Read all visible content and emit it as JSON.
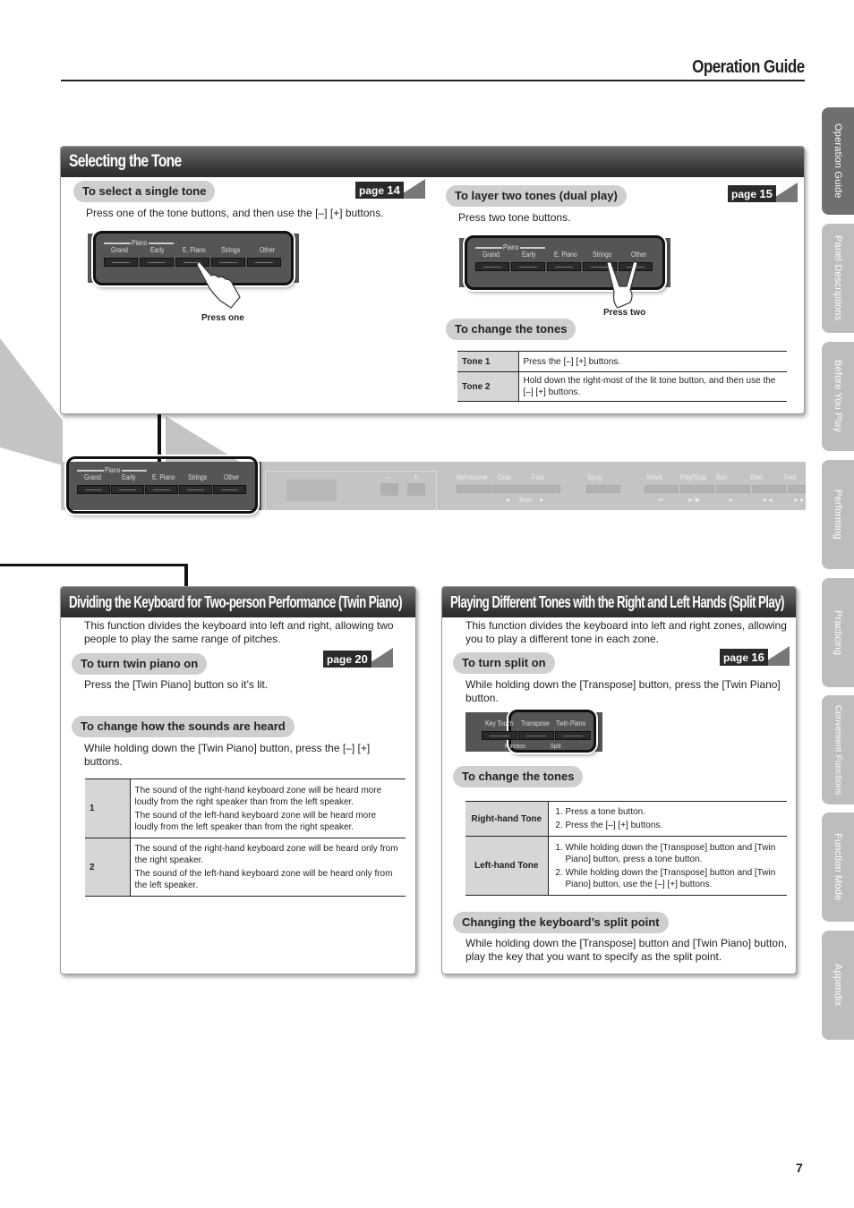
{
  "header": {
    "title": "Operation Guide"
  },
  "side_tabs": [
    {
      "label": "Operation Guide",
      "active": true
    },
    {
      "label": "Panel Descriptions",
      "active": false
    },
    {
      "label": "Before You Play",
      "active": false
    },
    {
      "label": "Performing",
      "active": false
    },
    {
      "label": "Practicing",
      "active": false
    },
    {
      "label": "Convenient Functions",
      "active": false
    },
    {
      "label": "Function Mode",
      "active": false
    },
    {
      "label": "Appendix",
      "active": false
    }
  ],
  "tone_buttons": {
    "group_label": "Piano",
    "labels": [
      "Grand",
      "Early",
      "E. Piano",
      "Strings",
      "Other"
    ]
  },
  "selecting_tone": {
    "title": "Selecting the Tone",
    "single": {
      "heading": "To select a single tone",
      "page_prefix": "page",
      "page_number": "14",
      "text": "Press one of the tone buttons, and then use the [–] [+] buttons.",
      "caption": "Press one"
    },
    "dual": {
      "heading": "To layer two tones (dual play)",
      "page_prefix": "page",
      "page_number": "15",
      "text": "Press two tone buttons.",
      "caption": "Press two"
    },
    "change": {
      "heading": "To change the tones",
      "rows": [
        {
          "label": "Tone 1",
          "text": "Press the [–] [+] buttons."
        },
        {
          "label": "Tone 2",
          "text": "Hold down the right-most of the lit tone button, and then use the [–] [+] buttons."
        }
      ]
    }
  },
  "front_panel": {
    "minus": "–",
    "plus": "+",
    "buttons": [
      "Metronome",
      "Slow",
      "Fast",
      "Song",
      "Reset",
      "Play/Stop",
      "Rec",
      "Bwd",
      "Fwd"
    ],
    "beat_label": "Beat",
    "sub_symbols": [
      "◄",
      "►",
      "⏮",
      "►/■",
      "●",
      "◄◄",
      "►►"
    ]
  },
  "twin_piano": {
    "title": "Dividing the Keyboard for Two-person Performance (Twin Piano)",
    "intro": "This function divides the keyboard into left and right, allowing two people to play the same range of pitches.",
    "turn_on": {
      "heading": "To turn twin piano on",
      "page_prefix": "page",
      "page_number": "20",
      "text": "Press the [Twin Piano] button so it’s lit."
    },
    "sounds": {
      "heading": "To change how the sounds are heard",
      "text": "While holding down the [Twin Piano] button, press the [–] [+] buttons.",
      "rows": [
        {
          "label": "1",
          "lines": [
            "The sound of the right-hand keyboard zone will be heard more loudly from the right speaker than from the left speaker.",
            "The sound of the left-hand keyboard zone will be heard more loudly from the left speaker than from the right speaker."
          ]
        },
        {
          "label": "2",
          "lines": [
            "The sound of the right-hand keyboard zone will be heard only from the right speaker.",
            "The sound of the left-hand keyboard zone will be heard only from the left speaker."
          ]
        }
      ]
    }
  },
  "split_play": {
    "title": "Playing Different Tones with the Right and Left Hands (Split Play)",
    "intro": "This function divides the keyboard into left and right zones, allowing you to play a different tone in each zone.",
    "turn_on": {
      "heading": "To turn split on",
      "page_prefix": "page",
      "page_number": "16",
      "text": "While holding down the [Transpose] button, press the [Twin Piano] button."
    },
    "panel_labels": [
      "Key Touch",
      "Transpose",
      "Twin Piano"
    ],
    "panel_sub": [
      "Function",
      "Split"
    ],
    "change": {
      "heading": "To change the tones",
      "rows": [
        {
          "label": "Right-hand Tone",
          "steps": [
            "Press a tone button.",
            "Press the [–] [+] buttons."
          ]
        },
        {
          "label": "Left-hand Tone",
          "steps": [
            "While holding down the [Transpose] button and [Twin Piano] button, press a tone button.",
            "While holding down the [Transpose] button and [Twin Piano] button, use the [–] [+] buttons."
          ]
        }
      ]
    },
    "split_point": {
      "heading": "Changing the keyboard’s split point",
      "text": "While holding down the [Transpose] button and [Twin Piano] button, play the key that you want to specify as the split point."
    }
  },
  "page_number": "7"
}
